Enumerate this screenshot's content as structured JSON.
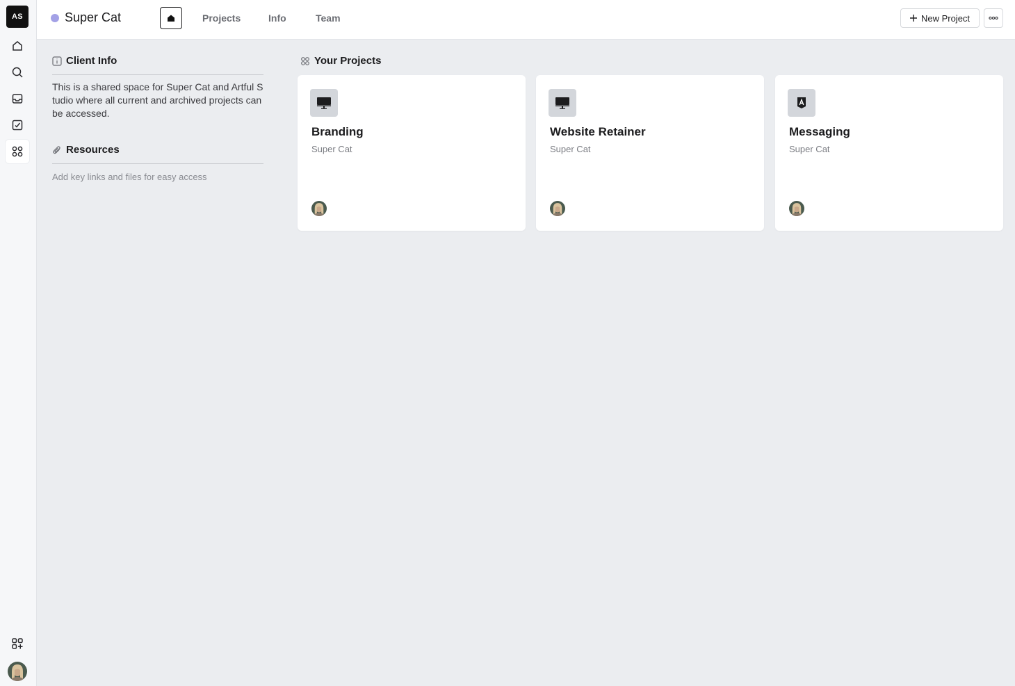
{
  "workspace": {
    "initials": "AS"
  },
  "rail": {
    "items": [
      {
        "icon": "home-icon"
      },
      {
        "icon": "search-icon"
      },
      {
        "icon": "inbox-icon"
      },
      {
        "icon": "tasks-icon"
      },
      {
        "icon": "apps-icon",
        "active": true
      }
    ],
    "bottom": [
      {
        "icon": "add-app-icon"
      },
      {
        "icon": "user-avatar"
      }
    ]
  },
  "header": {
    "client_name": "Super Cat",
    "client_color": "#a3a1e6",
    "tabs": [
      {
        "label": "Projects"
      },
      {
        "label": "Info"
      },
      {
        "label": "Team"
      }
    ],
    "new_project_label": "New Project"
  },
  "client_info": {
    "heading": "Client Info",
    "description": "This is a shared space for Super Cat and Artful Studio where all current and archived projects can be accessed."
  },
  "resources": {
    "heading": "Resources",
    "hint": "Add key links and files for easy access"
  },
  "projects": {
    "heading": "Your Projects",
    "items": [
      {
        "name": "Branding",
        "client": "Super Cat",
        "icon": "monitor-icon"
      },
      {
        "name": "Website Retainer",
        "client": "Super Cat",
        "icon": "monitor-icon"
      },
      {
        "name": "Messaging",
        "client": "Super Cat",
        "icon": "letter-a-badge-icon"
      }
    ]
  }
}
